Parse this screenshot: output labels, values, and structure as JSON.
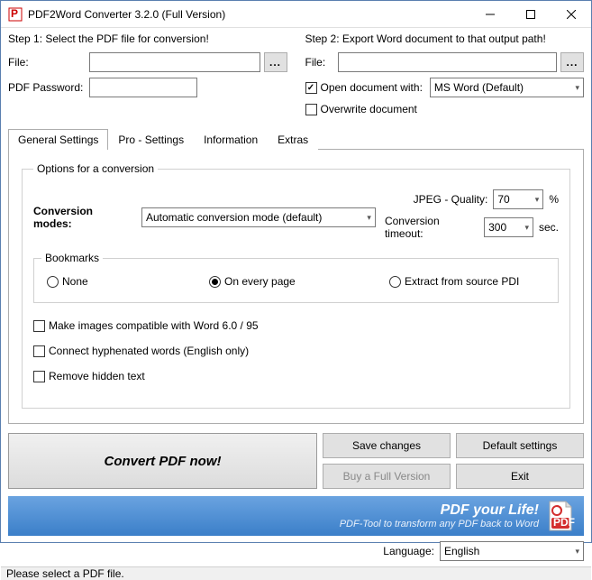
{
  "window": {
    "title": "PDF2Word Converter 3.2.0 (Full Version)"
  },
  "step1": {
    "title": "Step 1: Select the PDF file for conversion!",
    "file_label": "File:",
    "file_value": "",
    "browse": "...",
    "password_label": "PDF Password:",
    "password_value": ""
  },
  "step2": {
    "title": "Step 2: Export Word document to that output path!",
    "file_label": "File:",
    "file_value": "",
    "browse": "...",
    "open_with_label": "Open document with:",
    "open_with_checked": true,
    "open_with_value": "MS Word (Default)",
    "overwrite_label": "Overwrite document",
    "overwrite_checked": false
  },
  "tabs": {
    "general": "General Settings",
    "pro": "Pro - Settings",
    "info": "Information",
    "extras": "Extras"
  },
  "options": {
    "group_title": "Options for a conversion",
    "modes_label": "Conversion modes:",
    "modes_value": "Automatic conversion mode (default)",
    "jpeg_label": "JPEG - Quality:",
    "jpeg_value": "70",
    "jpeg_unit": "%",
    "timeout_label": "Conversion timeout:",
    "timeout_value": "300",
    "timeout_unit": "sec.",
    "bookmarks_title": "Bookmarks",
    "bm_none": "None",
    "bm_every": "On every page",
    "bm_extract": "Extract from source PDI",
    "bm_selected": "every",
    "compat_label": "Make images compatible with Word 6.0 / 95",
    "hyphen_label": "Connect hyphenated words (English only)",
    "hidden_label": "Remove hidden text"
  },
  "buttons": {
    "convert": "Convert PDF now!",
    "save": "Save changes",
    "defaults": "Default settings",
    "buy": "Buy a Full Version",
    "exit": "Exit"
  },
  "banner": {
    "title": "PDF your Life!",
    "subtitle": "PDF-Tool to transform any PDF back to Word"
  },
  "language": {
    "label": "Language:",
    "value": "English"
  },
  "status": "Please select a PDF file."
}
